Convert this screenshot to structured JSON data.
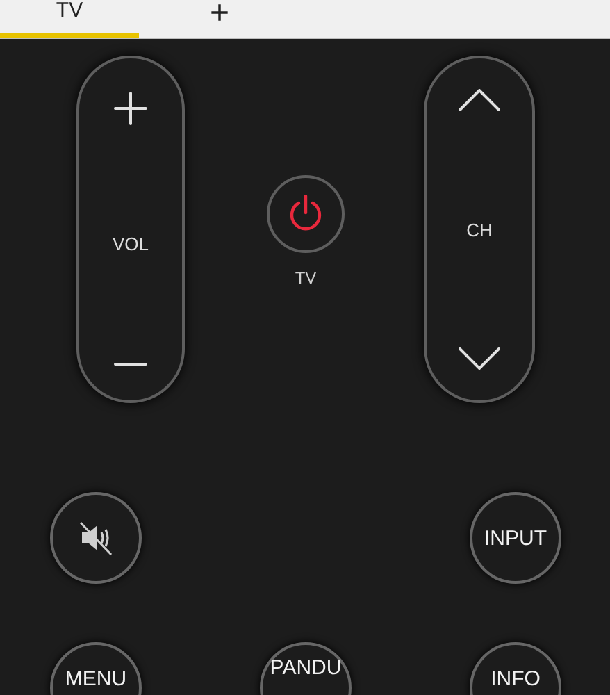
{
  "tabs": [
    {
      "label": "TV",
      "selected": true
    },
    {
      "label": "+",
      "selected": false
    }
  ],
  "volume": {
    "label": "VOL"
  },
  "channel": {
    "label": "CH"
  },
  "power": {
    "label": "TV"
  },
  "buttons": [
    {
      "kind": "mute"
    },
    {
      "kind": "text",
      "label": "INPUT"
    },
    {
      "kind": "text",
      "label": "MENU"
    },
    {
      "kind": "text",
      "label": "PANDU"
    },
    {
      "kind": "text",
      "label": "INFO"
    }
  ]
}
